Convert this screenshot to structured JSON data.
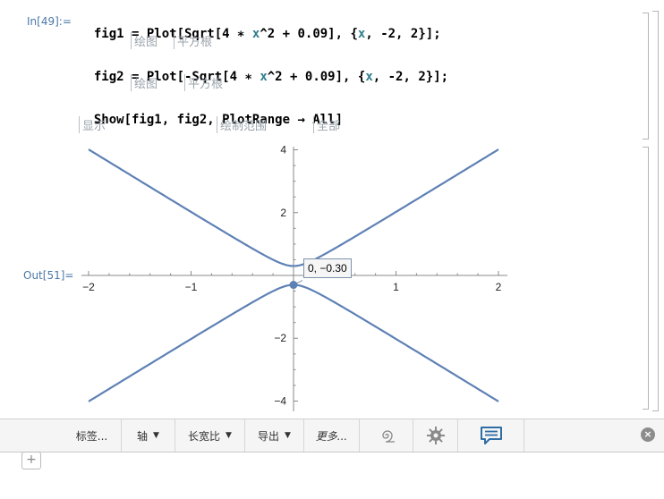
{
  "input_cell": {
    "label": "In[49]:=",
    "lines": [
      {
        "p1": "fig1 = Plot[Sqrt[4 ",
        "star": "∗",
        "p2": " ",
        "var1": "x",
        "p3": "^2 + 0.09], {",
        "var2": "x",
        "p4": ", -2, 2}];",
        "hints": [
          "绘图",
          "平方根"
        ]
      },
      {
        "p1": "fig2 = Plot[-Sqrt[4 ",
        "star": "∗",
        "p2": " ",
        "var1": "x",
        "p3": "^2 + 0.09], {",
        "var2": "x",
        "p4": ", -2, 2}];",
        "hints": [
          "绘图",
          "平方根"
        ]
      },
      {
        "p1": "Show[fig1, fig2, PlotRange ",
        "arrow": "→",
        "p2": " All]",
        "hints": [
          "显示",
          "绘制范围",
          "全部"
        ]
      }
    ]
  },
  "output_cell": {
    "label": "Out[51]="
  },
  "tooltip": {
    "text": "0, −0.30"
  },
  "chart_data": {
    "type": "line",
    "title": "",
    "xlabel": "",
    "ylabel": "",
    "xlim": [
      -2,
      2
    ],
    "ylim": [
      -4.1,
      4.1
    ],
    "x_ticks": [
      -2,
      -1,
      1,
      2
    ],
    "x_tick_labels": [
      "−2",
      "−1",
      "1",
      "2"
    ],
    "y_ticks": [
      4,
      2,
      -2,
      -4
    ],
    "y_tick_labels": [
      "4",
      "2",
      "−2",
      "−4"
    ],
    "series": [
      {
        "x": [
          -2,
          -1.5,
          -1,
          -0.5,
          -0.2,
          0,
          0.2,
          0.5,
          1,
          1.5,
          2
        ],
        "y": [
          4.011,
          3.015,
          2.022,
          1.044,
          0.5,
          0.3,
          0.5,
          1.044,
          2.022,
          3.015,
          4.011
        ]
      },
      {
        "x": [
          -2,
          -1.5,
          -1,
          -0.5,
          -0.2,
          0,
          0.2,
          0.5,
          1,
          1.5,
          2
        ],
        "y": [
          -4.011,
          -3.015,
          -2.022,
          -1.044,
          -0.5,
          -0.3,
          -0.5,
          -1.044,
          -2.022,
          -3.015,
          -4.011
        ]
      }
    ],
    "highlight_point": {
      "x": 0,
      "y": -0.3
    },
    "line_color": "#5e81b5",
    "grid": false
  },
  "toolbar": {
    "items": [
      {
        "label": "标签...",
        "has_arrow": false,
        "italic": false
      },
      {
        "label": "轴",
        "has_arrow": true,
        "italic": false
      },
      {
        "label": "长宽比",
        "has_arrow": true,
        "italic": false
      },
      {
        "label": "导出",
        "has_arrow": true,
        "italic": false
      },
      {
        "label": "更多...",
        "has_arrow": false,
        "italic": true
      }
    ],
    "icons": [
      "spiral-icon",
      "gear-icon",
      "chat-icon"
    ],
    "close_glyph": "×",
    "chat_icon_color": "#2f6ea5"
  },
  "add_glyph": "+"
}
